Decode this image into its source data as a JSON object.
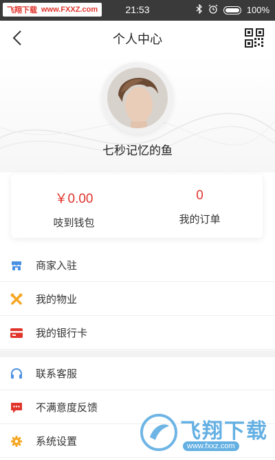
{
  "status_bar": {
    "watermark_cn": "飞翔下载",
    "watermark_url": "www.FXXZ.com",
    "time": "21:53",
    "battery": "100%"
  },
  "header": {
    "title": "个人中心"
  },
  "profile": {
    "username": "七秒记忆的鱼"
  },
  "stats": [
    {
      "value": "￥0.00",
      "label": "吱到钱包"
    },
    {
      "value": "0",
      "label": "我的订单"
    }
  ],
  "menu_group_1": [
    {
      "label": "商家入驻",
      "icon": "store-icon",
      "color": "#4a90e2"
    },
    {
      "label": "我的物业",
      "icon": "tools-icon",
      "color": "#f5a623"
    },
    {
      "label": "我的银行卡",
      "icon": "bank-card-icon",
      "color": "#e0342c"
    }
  ],
  "menu_group_2": [
    {
      "label": "联系客服",
      "icon": "headset-icon",
      "color": "#4a90e2"
    },
    {
      "label": "不满意度反馈",
      "icon": "feedback-icon",
      "color": "#e0342c"
    },
    {
      "label": "系统设置",
      "icon": "gear-icon",
      "color": "#f5a623"
    }
  ],
  "bottom_watermark": {
    "title": "飞翔下载",
    "url": "www.fxxz.com"
  },
  "colors": {
    "accent_red": "#e0342c",
    "blue": "#4a90e2",
    "orange": "#f5a623"
  }
}
